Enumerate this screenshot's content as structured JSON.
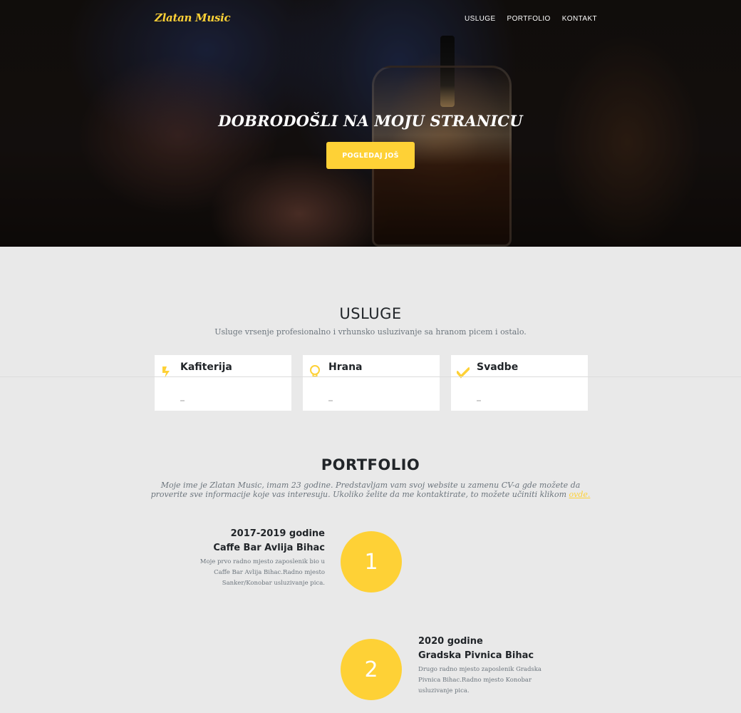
{
  "nav": {
    "brand": "Zlatan Music",
    "links": [
      "USLUGE",
      "PORTFOLIO",
      "KONTAKT"
    ]
  },
  "hero": {
    "title": "DOBRODOŠLI NA MOJU STRANICU",
    "button": "POGLEDAJ JOŠ"
  },
  "services": {
    "title": "USLUGE",
    "subtitle": "Usluge vrsenje profesionalno i vrhunsko usluzivanje sa hranom picem i ostalo.",
    "cards": [
      {
        "title": "Kafiterija",
        "icon": "lightning-icon"
      },
      {
        "title": "Hrana",
        "icon": "lightbulb-icon"
      },
      {
        "title": "Svadbe",
        "icon": "checkmark-icon"
      }
    ]
  },
  "portfolio": {
    "title": "PORTFOLIO",
    "intro": "Moje ime je Zlatan Music, imam 23 godine. Predstavljam vam svoj website u zamenu CV-a gde možete da proverite sve informacije koje vas interesuju. Ukoliko želite da me kontaktirate, to možete učiniti klikom",
    "intro_link": "ovde.",
    "timeline": [
      {
        "number": "1",
        "years": "2017-2019 godine",
        "place": "Caffe Bar Avlija Bihac",
        "description": "Moje prvo radno mjesto zaposlenik bio u Caffe Bar Avlija Bihac.Radno mjesto Sanker/Konobar usluzivanje pica."
      },
      {
        "number": "2",
        "years": "2020 godine",
        "place": "Gradska Pivnica Bihac",
        "description": "Drugo radno mjesto zaposlenik Gradska Pivnica Bihac.Radno mjesto Konobar usluzivanje pica."
      }
    ]
  },
  "colors": {
    "accent": "#fed136",
    "background": "#e9e9e9",
    "text": "#212529",
    "muted": "#6c757d"
  }
}
